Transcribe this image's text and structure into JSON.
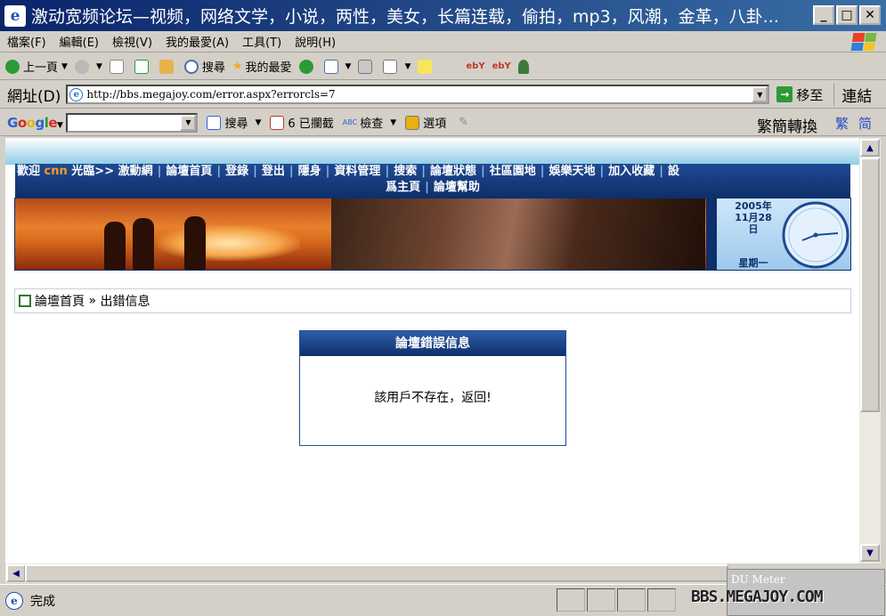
{
  "window": {
    "title": "激动宽频论坛—视频，网络文学，小说，两性，美女，长篇连载，偷拍，mp3，风潮，金革，八卦...",
    "minimize": "_",
    "maximize": "□",
    "close": "✕"
  },
  "menu": [
    "檔案(F)",
    "編輯(E)",
    "檢視(V)",
    "我的最愛(A)",
    "工具(T)",
    "說明(H)"
  ],
  "toolbar": {
    "back": "上一頁",
    "search": "搜尋",
    "favorites": "我的最愛"
  },
  "address": {
    "label": "網址(D)",
    "url": "http://bbs.megajoy.com/error.aspx?errorcls=7",
    "go": "移至",
    "links": "連結"
  },
  "google_bar": {
    "logo": "Google",
    "search": "搜尋",
    "blocked": "6 已攔截",
    "check": "檢查",
    "options": "選項",
    "convert": "繁簡轉換",
    "traditional": "繁",
    "simplified": "简"
  },
  "site": {
    "nav": {
      "welcome_prefix": "歡迎",
      "user": "cnn",
      "welcome_suffix": "光臨>> 激動網",
      "links": [
        "論壇首頁",
        "登錄",
        "登出",
        "隱身",
        "資料管理",
        "搜索",
        "論壇狀態",
        "社區園地",
        "娛樂天地",
        "加入收藏",
        "設"
      ],
      "links_row2": [
        "爲主頁",
        "論壇幫助"
      ]
    },
    "date": {
      "year": "2005年",
      "month_day": "11月28",
      "day_suffix": "日",
      "weekday": "星期一"
    },
    "breadcrumb": {
      "home": "論壇首頁",
      "separator": "»",
      "current": "出錯信息"
    },
    "error": {
      "title": "論壇錯誤信息",
      "message": "該用戶不存在，返回!"
    }
  },
  "status": {
    "text": "完成"
  },
  "du_meter": {
    "title": "DU Meter"
  },
  "watermark": "BBS.MEGAJOY.COM"
}
